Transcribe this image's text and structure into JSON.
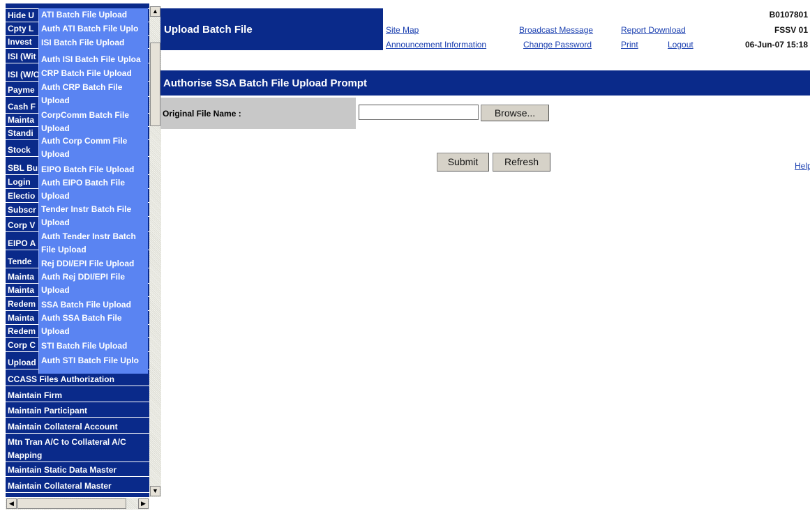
{
  "left_menu": {
    "items": [
      "Hide U",
      "Cpty L",
      "Invest",
      "ISI (Wit",
      "ISI (W/O",
      "Payme",
      "Cash F",
      "Mainta",
      "Standi",
      "Stock",
      "SBL Bu",
      "Login",
      "Electio",
      "Subscr",
      "Corp V",
      "EIPO A",
      "Tende",
      "Mainta",
      "Mainta",
      "Redem",
      "Mainta",
      "Redem",
      "Corp C",
      "Upload",
      "CCASS Files Authorization",
      "Maintain Firm",
      "Maintain Participant",
      "Maintain Collateral Account",
      "Mtn Tran A/C to Collateral A/C Mapping",
      "Maintain Static Data Master",
      "Maintain Collateral Master"
    ],
    "submenu": [
      "ATI Batch File Upload",
      "Auth ATI Batch File Uplo",
      "ISI Batch File Upload",
      "Auth ISI Batch File Uploa",
      "CRP Batch File Upload",
      "Auth CRP Batch File Upload",
      "CorpComm Batch File Upload",
      "Auth Corp Comm File Upload",
      "EIPO Batch File Upload",
      "Auth EIPO Batch File Upload",
      "Tender Instr Batch File Upload",
      "Auth Tender Instr Batch File Upload",
      "Rej DDI/EPI File Upload",
      "Auth Rej DDI/EPI File Upload",
      "SSA Batch File Upload",
      "Auth SSA Batch File Upload",
      "STI Batch File Upload",
      "Auth STI Batch File Uplo"
    ]
  },
  "header": {
    "title": "Upload Batch File",
    "links": {
      "site_map": "Site Map",
      "announcement": "Announcement Information",
      "broadcast": "Broadcast Message",
      "change_password": "Change Password",
      "report_download": "Report Download",
      "print": "Print",
      "logout": "Logout"
    },
    "user_id": "B0107801",
    "server": "FSSV 01",
    "datetime": "06-Jun-07 15:18"
  },
  "page": {
    "heading": "Authorise SSA Batch File Upload Prompt",
    "file_label": "Original File Name :",
    "file_value": "",
    "browse_label": "Browse...",
    "submit_label": "Submit",
    "refresh_label": "Refresh",
    "help_label": "Help"
  },
  "colors": {
    "nav_blue": "#0a2a8a",
    "submenu_blue": "#5a84f2",
    "link_blue": "#1a3fb0",
    "label_gray": "#c8c8c8"
  }
}
